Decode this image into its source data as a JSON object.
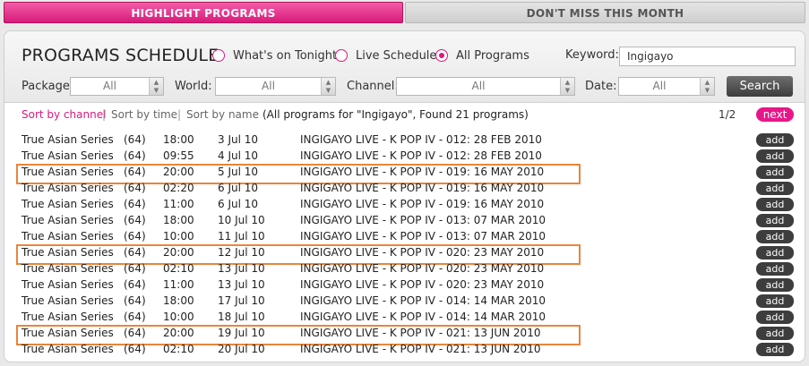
{
  "tabs": {
    "highlight": "HIGHLIGHT PROGRAMS",
    "dont_miss": "DON'T MISS THIS MONTH"
  },
  "header": {
    "title": "PROGRAMS SCHEDULE"
  },
  "radios": [
    {
      "label": "What's on Tonight",
      "checked": false
    },
    {
      "label": "Live Schedule",
      "checked": false
    },
    {
      "label": "All Programs",
      "checked": true
    }
  ],
  "keyword": {
    "label": "Keyword:",
    "value": "Ingigayo"
  },
  "filters": {
    "package_label": "Package:",
    "package_value": "All",
    "world_label": "World:",
    "world_value": "All",
    "channel_label": "Channel:",
    "channel_value": "All",
    "date_label": "Date:",
    "date_value": "All",
    "search_label": "Search"
  },
  "sort": {
    "by_channel": "Sort by channel",
    "by_time": "Sort by time",
    "by_name": "Sort by name",
    "separator": "|",
    "dash": "-",
    "result_text": "(All programs for \"Ingigayo\", Found 21 programs)",
    "page": "1/2",
    "next": "next"
  },
  "row_add_label": "add",
  "rows": [
    {
      "channel": "True Asian Series",
      "num": "(64)",
      "time": "18:00",
      "date": "3 Jul 10",
      "title": "INGIGAYO LIVE - K POP IV - 012: 28 FEB 2010",
      "highlighted": false
    },
    {
      "channel": "True Asian Series",
      "num": "(64)",
      "time": "09:55",
      "date": "4 Jul 10",
      "title": "INGIGAYO LIVE - K POP IV - 012: 28 FEB 2010",
      "highlighted": false
    },
    {
      "channel": "True Asian Series",
      "num": "(64)",
      "time": "20:00",
      "date": "5 Jul 10",
      "title": "INGIGAYO LIVE - K POP IV - 019: 16 MAY 2010",
      "highlighted": true
    },
    {
      "channel": "True Asian Series",
      "num": "(64)",
      "time": "02:20",
      "date": "6 Jul 10",
      "title": "INGIGAYO LIVE - K POP IV - 019: 16 MAY 2010",
      "highlighted": false
    },
    {
      "channel": "True Asian Series",
      "num": "(64)",
      "time": "11:00",
      "date": "6 Jul 10",
      "title": "INGIGAYO LIVE - K POP IV - 019: 16 MAY 2010",
      "highlighted": false
    },
    {
      "channel": "True Asian Series",
      "num": "(64)",
      "time": "18:00",
      "date": "10 Jul 10",
      "title": "INGIGAYO LIVE - K POP IV - 013: 07 MAR 2010",
      "highlighted": false
    },
    {
      "channel": "True Asian Series",
      "num": "(64)",
      "time": "10:00",
      "date": "11 Jul 10",
      "title": "INGIGAYO LIVE - K POP IV - 013: 07 MAR 2010",
      "highlighted": false
    },
    {
      "channel": "True Asian Series",
      "num": "(64)",
      "time": "20:00",
      "date": "12 Jul 10",
      "title": "INGIGAYO LIVE - K POP IV - 020: 23 MAY 2010",
      "highlighted": true
    },
    {
      "channel": "True Asian Series",
      "num": "(64)",
      "time": "02:10",
      "date": "13 Jul 10",
      "title": "INGIGAYO LIVE - K POP IV - 020: 23 MAY 2010",
      "highlighted": false
    },
    {
      "channel": "True Asian Series",
      "num": "(64)",
      "time": "11:00",
      "date": "13 Jul 10",
      "title": "INGIGAYO LIVE - K POP IV - 020: 23 MAY 2010",
      "highlighted": false
    },
    {
      "channel": "True Asian Series",
      "num": "(64)",
      "time": "18:00",
      "date": "17 Jul 10",
      "title": "INGIGAYO LIVE - K POP IV - 014: 14 MAR 2010",
      "highlighted": false
    },
    {
      "channel": "True Asian Series",
      "num": "(64)",
      "time": "10:00",
      "date": "18 Jul 10",
      "title": "INGIGAYO LIVE - K POP IV - 014: 14 MAR 2010",
      "highlighted": false
    },
    {
      "channel": "True Asian Series",
      "num": "(64)",
      "time": "20:00",
      "date": "19 Jul 10",
      "title": "INGIGAYO LIVE - K POP IV - 021: 13 JUN 2010",
      "highlighted": true
    },
    {
      "channel": "True Asian Series",
      "num": "(64)",
      "time": "02:10",
      "date": "20 Jul 10",
      "title": "INGIGAYO LIVE - K POP IV - 021: 13 JUN 2010",
      "highlighted": false
    }
  ]
}
